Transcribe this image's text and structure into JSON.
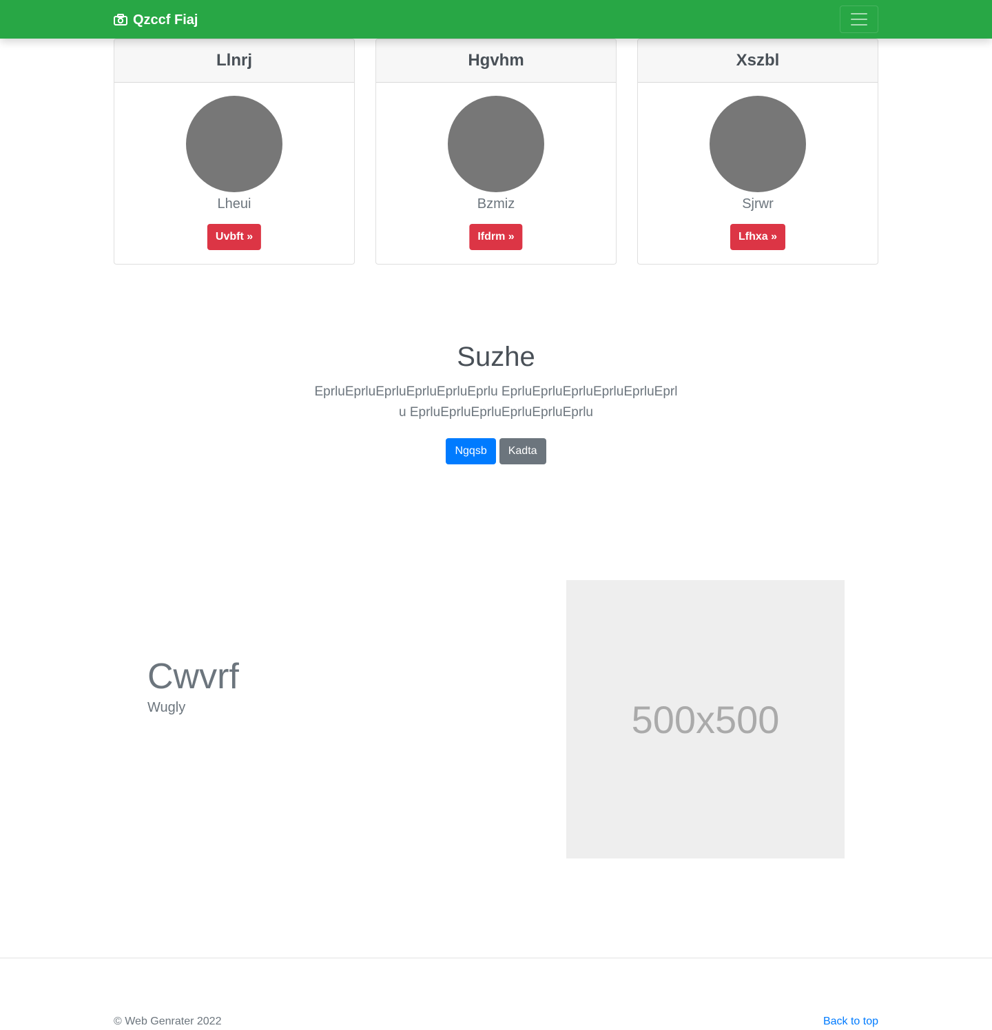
{
  "navbar": {
    "brand": "Qzccf Fiaj",
    "brand_icon": "camera-icon",
    "toggler_icon": "hamburger-menu-icon"
  },
  "cards": [
    {
      "title": "Llnrj",
      "name": "Lheui",
      "button": "Uvbft »"
    },
    {
      "title": "Hgvhm",
      "name": "Bzmiz",
      "button": "Ifdrm »"
    },
    {
      "title": "Xszbl",
      "name": "Sjrwr",
      "button": "Lfhxa »"
    }
  ],
  "hero": {
    "title": "Suzhe",
    "text": "EprluEprluEprluEprluEprluEprlu EprluEprluEprluEprluEprluEprlu EprluEprluEprluEprluEprluEprlu",
    "primary_button": "Ngqsb",
    "secondary_button": "Kadta"
  },
  "feature": {
    "title": "Cwvrf",
    "subtitle": "Wugly",
    "image_label": "500x500"
  },
  "footer": {
    "copyright": "© Web Genrater 2022",
    "back_to_top": "Back to top"
  },
  "colors": {
    "navbar": "#28a745",
    "danger": "#dc3545",
    "primary": "#007bff",
    "secondary": "#6c757d"
  }
}
